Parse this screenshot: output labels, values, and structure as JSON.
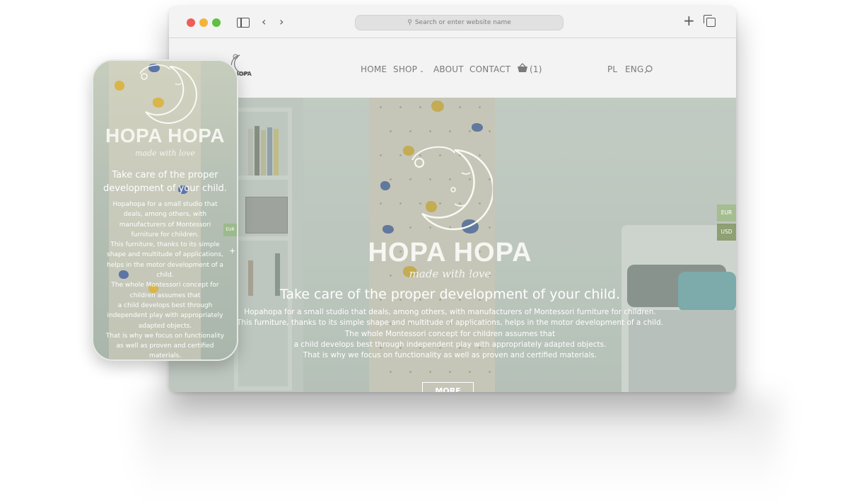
{
  "browser": {
    "address_placeholder": "Search or enter website name",
    "icons": [
      "sidebar-icon",
      "back-icon",
      "forward-icon",
      "search-icon",
      "plus-icon",
      "tabs-icon"
    ]
  },
  "site": {
    "logo_text": "HOPA",
    "nav": {
      "home": "HOME",
      "shop": "SHOP",
      "about": "ABOUT",
      "contact": "CONTACT",
      "cart_count": "(1)",
      "lang_pl": "PL",
      "lang_eng": "ENG"
    },
    "hero": {
      "brand": "HOPA HOPA",
      "tagline": "made with love",
      "heading": "Take care of the proper development of your child.",
      "lines": [
        "Hopahopa for a small studio that deals, among others, with manufacturers of Montessori furniture for children.",
        "This furniture, thanks to its simple shape and multitude of applications, helps in the motor development of a child.",
        "The whole Montessori concept for children assumes that",
        "a child develops best through independent play with appropriately adapted objects.",
        "That is why we focus on functionality as well as proven and certified materials."
      ],
      "more_button": "MORE"
    },
    "currency": [
      "EUR",
      "USD"
    ]
  },
  "phone": {
    "brand": "HOPA HOPA",
    "tagline": "made with love",
    "heading_lines": [
      "Take care of the proper",
      "development of your child."
    ],
    "text_lines": [
      "Hopahopa for a small studio that",
      "deals, among others, with",
      "manufacturers of Montessori",
      "furniture for children.",
      "This furniture, thanks to its simple",
      "shape and multitude of applications,",
      "helps in the motor development of a",
      "child.",
      "The whole Montessori concept for",
      "children assumes that",
      "a child develops best through",
      "independent play with appropriately",
      "adapted objects.",
      "That is why we focus on functionality",
      "as well as proven and certified",
      "materials."
    ],
    "currency": "EUR",
    "plus": "+"
  },
  "colors": {
    "dot_red": "#ee5d57",
    "dot_yellow": "#f1b43c",
    "dot_green": "#5cc23f",
    "hold_yellow": "#d9b54a",
    "hold_blue": "#5c74a6",
    "currency_green": "#8fae6e"
  }
}
